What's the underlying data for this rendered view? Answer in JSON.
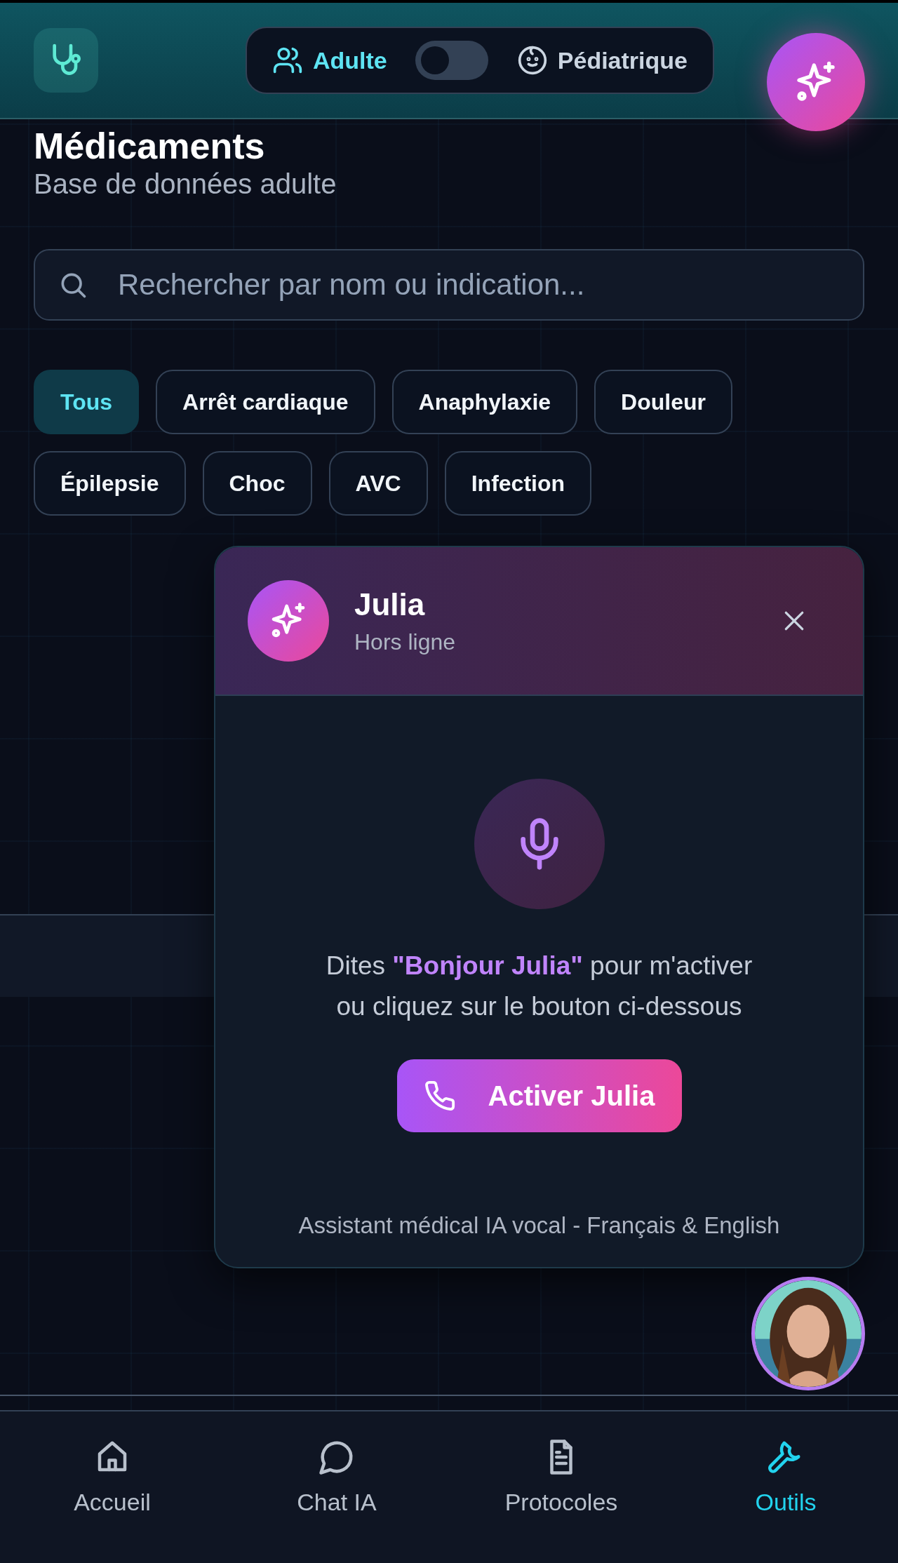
{
  "header": {
    "mode_toggle": {
      "options": [
        {
          "label": "Adulte",
          "selected": true
        },
        {
          "label": "Pédiatrique",
          "selected": false
        }
      ],
      "switch": {
        "on": false
      }
    }
  },
  "page": {
    "title": "Médicaments",
    "subtitle": "Base de données adulte"
  },
  "search": {
    "placeholder": "Rechercher par nom ou indication..."
  },
  "filters": [
    {
      "label": "Tous",
      "selected": true
    },
    {
      "label": "Arrêt cardiaque",
      "selected": false
    },
    {
      "label": "Anaphylaxie",
      "selected": false
    },
    {
      "label": "Douleur",
      "selected": false
    },
    {
      "label": "Épilepsie",
      "selected": false
    },
    {
      "label": "Choc",
      "selected": false
    },
    {
      "label": "AVC",
      "selected": false
    },
    {
      "label": "Infection",
      "selected": false
    }
  ],
  "assistant": {
    "name": "Julia",
    "status": "Hors ligne",
    "hint": "Dites **\"Bonjour Julia\"** pour m'activer ou cliquez sur le bouton ci-dessous",
    "button": "Activer Julia",
    "footer": "Assistant médical IA vocal - Français & English"
  },
  "nav": [
    {
      "label": "Accueil",
      "selected": false
    },
    {
      "label": "Chat IA",
      "selected": false
    },
    {
      "label": "Protocoles",
      "selected": false
    },
    {
      "label": "Outils",
      "selected": true
    }
  ]
}
